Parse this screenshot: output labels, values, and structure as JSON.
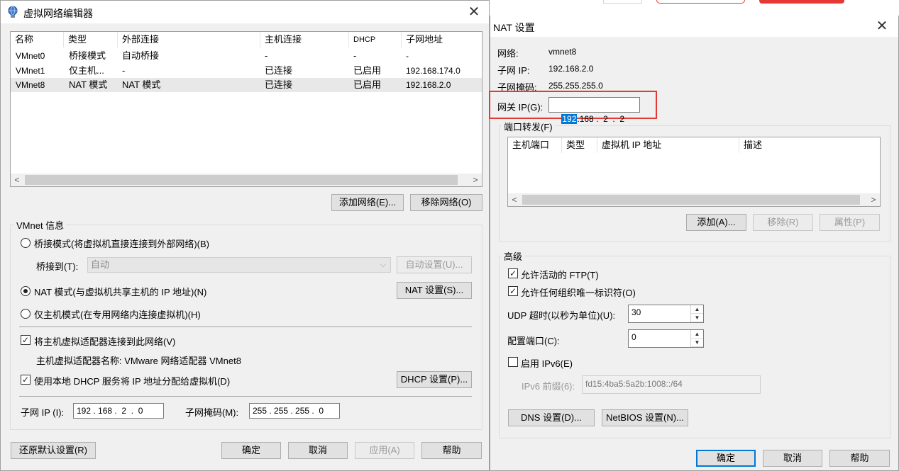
{
  "left": {
    "title": "虚拟网络编辑器",
    "columns": [
      "名称",
      "类型",
      "外部连接",
      "主机连接",
      "DHCP",
      "子网地址"
    ],
    "rows": [
      [
        "VMnet0",
        "桥接模式",
        "自动桥接",
        "-",
        "-",
        "-"
      ],
      [
        "VMnet1",
        "仅主机...",
        "-",
        "已连接",
        "已启用",
        "192.168.174.0"
      ],
      [
        "VMnet8",
        "NAT 模式",
        "NAT 模式",
        "已连接",
        "已启用",
        "192.168.2.0"
      ]
    ],
    "add_network": "添加网络(E)...",
    "remove_network": "移除网络(O)",
    "group_label": "VMnet 信息",
    "bridge_mode": "桥接模式(将虚拟机直接连接到外部网络)(B)",
    "bridge_to_label": "桥接到(T):",
    "bridge_to_value": "自动",
    "auto_settings": "自动设置(U)...",
    "nat_mode": "NAT 模式(与虚拟机共享主机的 IP 地址)(N)",
    "nat_settings": "NAT 设置(S)...",
    "host_only": "仅主机模式(在专用网络内连接虚拟机)(H)",
    "connect_adapter": "将主机虚拟适配器连接到此网络(V)",
    "adapter_name": "主机虚拟适配器名称: VMware 网络适配器 VMnet8",
    "use_dhcp": "使用本地 DHCP 服务将 IP 地址分配给虚拟机(D)",
    "dhcp_settings": "DHCP 设置(P)...",
    "subnet_ip_label": "子网 IP (I):",
    "subnet_ip": "192 . 168 .  2  .  0",
    "subnet_mask_label": "子网掩码(M):",
    "subnet_mask": "255 . 255 . 255 .  0",
    "restore": "还原默认设置(R)",
    "ok": "确定",
    "cancel": "取消",
    "apply": "应用(A)",
    "help": "帮助"
  },
  "right": {
    "title": "NAT 设置",
    "network_label": "网络:",
    "network_value": "vmnet8",
    "subnet_ip_label": "子网 IP:",
    "subnet_ip_value": "192.168.2.0",
    "subnet_mask_label": "子网掩码:",
    "subnet_mask_value": "255.255.255.0",
    "gateway_label": "网关 IP(G):",
    "gateway_first": "192",
    "gateway_rest": ".168 .  2  .  2",
    "port_forward_label": "端口转发(F)",
    "pf_columns": [
      "主机端口",
      "类型",
      "虚拟机 IP 地址",
      "描述"
    ],
    "add": "添加(A)...",
    "remove": "移除(R)",
    "properties": "属性(P)",
    "advanced_label": "高级",
    "allow_ftp": "允许活动的 FTP(T)",
    "allow_oui": "允许任何组织唯一标识符(O)",
    "udp_timeout_label": "UDP 超时(以秒为单位)(U):",
    "udp_timeout": "30",
    "config_port_label": "配置端口(C):",
    "config_port": "0",
    "enable_ipv6": "启用 IPv6(E)",
    "ipv6_prefix_label": "IPv6 前缀(6):",
    "ipv6_prefix": "fd15:4ba5:5a2b:1008::/64",
    "dns_settings": "DNS 设置(D)...",
    "netbios_settings": "NetBIOS 设置(N)...",
    "ok": "确定",
    "cancel": "取消",
    "help": "帮助"
  },
  "colors": {
    "highlight_box": "#e53935",
    "selection": "#0078d7"
  }
}
